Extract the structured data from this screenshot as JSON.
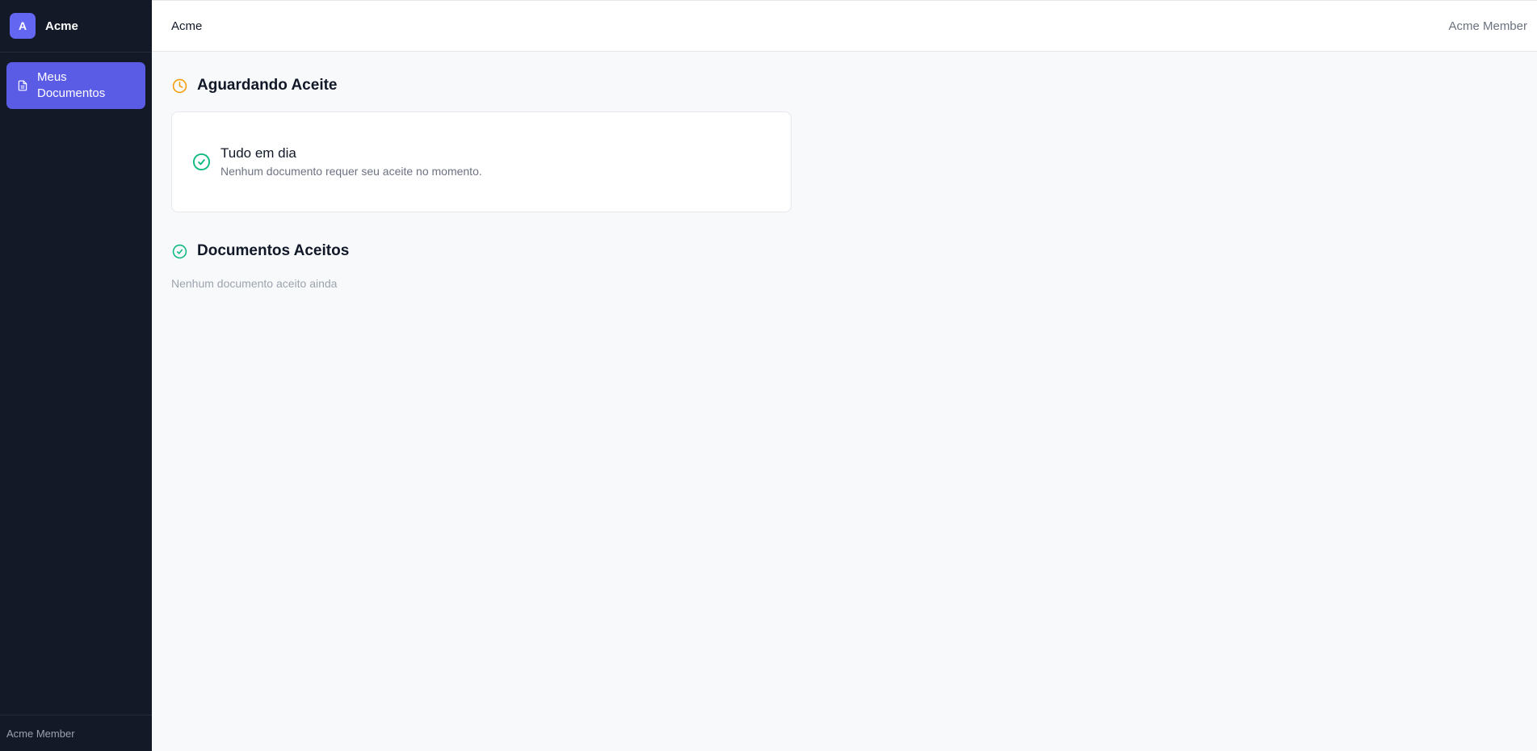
{
  "sidebar": {
    "brand": {
      "avatar_letter": "A",
      "name": "Acme"
    },
    "items": [
      {
        "label": "Meus Documentos",
        "icon": "document-icon",
        "active": true
      }
    ],
    "footer": "Acme Member"
  },
  "header": {
    "title": "Acme",
    "user": "Acme Member"
  },
  "pending": {
    "title": "Aguardando Aceite",
    "icon": "clock-icon",
    "empty_state": {
      "icon": "check-circle-icon",
      "title": "Tudo em dia",
      "subtitle": "Nenhum documento requer seu aceite no momento."
    }
  },
  "accepted": {
    "title": "Documentos Aceitos",
    "icon": "check-circle-icon",
    "empty_text": "Nenhum documento aceito ainda"
  },
  "colors": {
    "sidebar_bg": "#141927",
    "accent": "#5b5ce6",
    "brand_avatar": "#6366f1",
    "warning": "#f59e0b",
    "success": "#10b981"
  }
}
